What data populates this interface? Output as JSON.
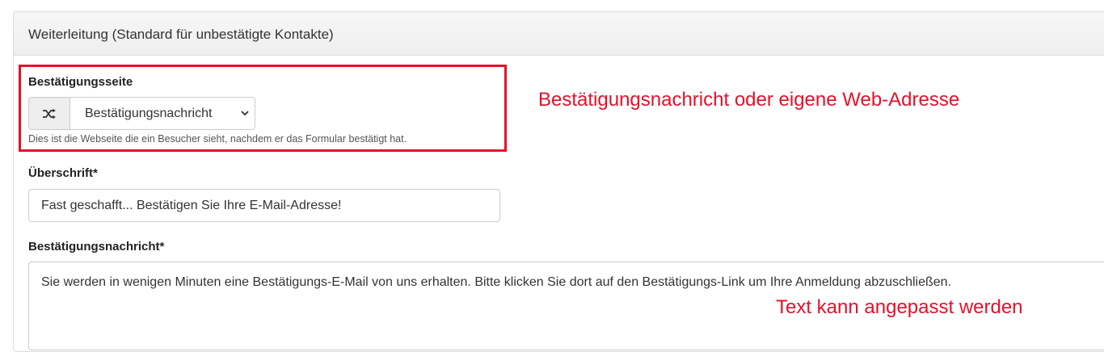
{
  "panel": {
    "title": "Weiterleitung (Standard für unbestätigte Kontakte)"
  },
  "confirmation_page": {
    "label": "Bestätigungsseite",
    "addon_icon": "shuffle-icon",
    "selected_option": "Bestätigungsnachricht",
    "help_text": "Dies ist die Webseite die ein Besucher sieht, nachdem er das Formular bestätigt hat."
  },
  "headline": {
    "label": "Überschrift*",
    "value": "Fast geschafft... Bestätigen Sie Ihre E-Mail-Adresse!"
  },
  "confirmation_message": {
    "label": "Bestätigungsnachricht*",
    "value": "Sie werden in wenigen Minuten eine Bestätigungs-E-Mail von uns erhalten. Bitte klicken Sie dort auf den Bestätigungs-Link um Ihre Anmeldung abzuschließen."
  },
  "annotations": {
    "select_note": "Bestätigungsnachricht oder eigene Web-Adresse",
    "text_note": "Text kann angepasst werden",
    "color": "#e4112b"
  }
}
